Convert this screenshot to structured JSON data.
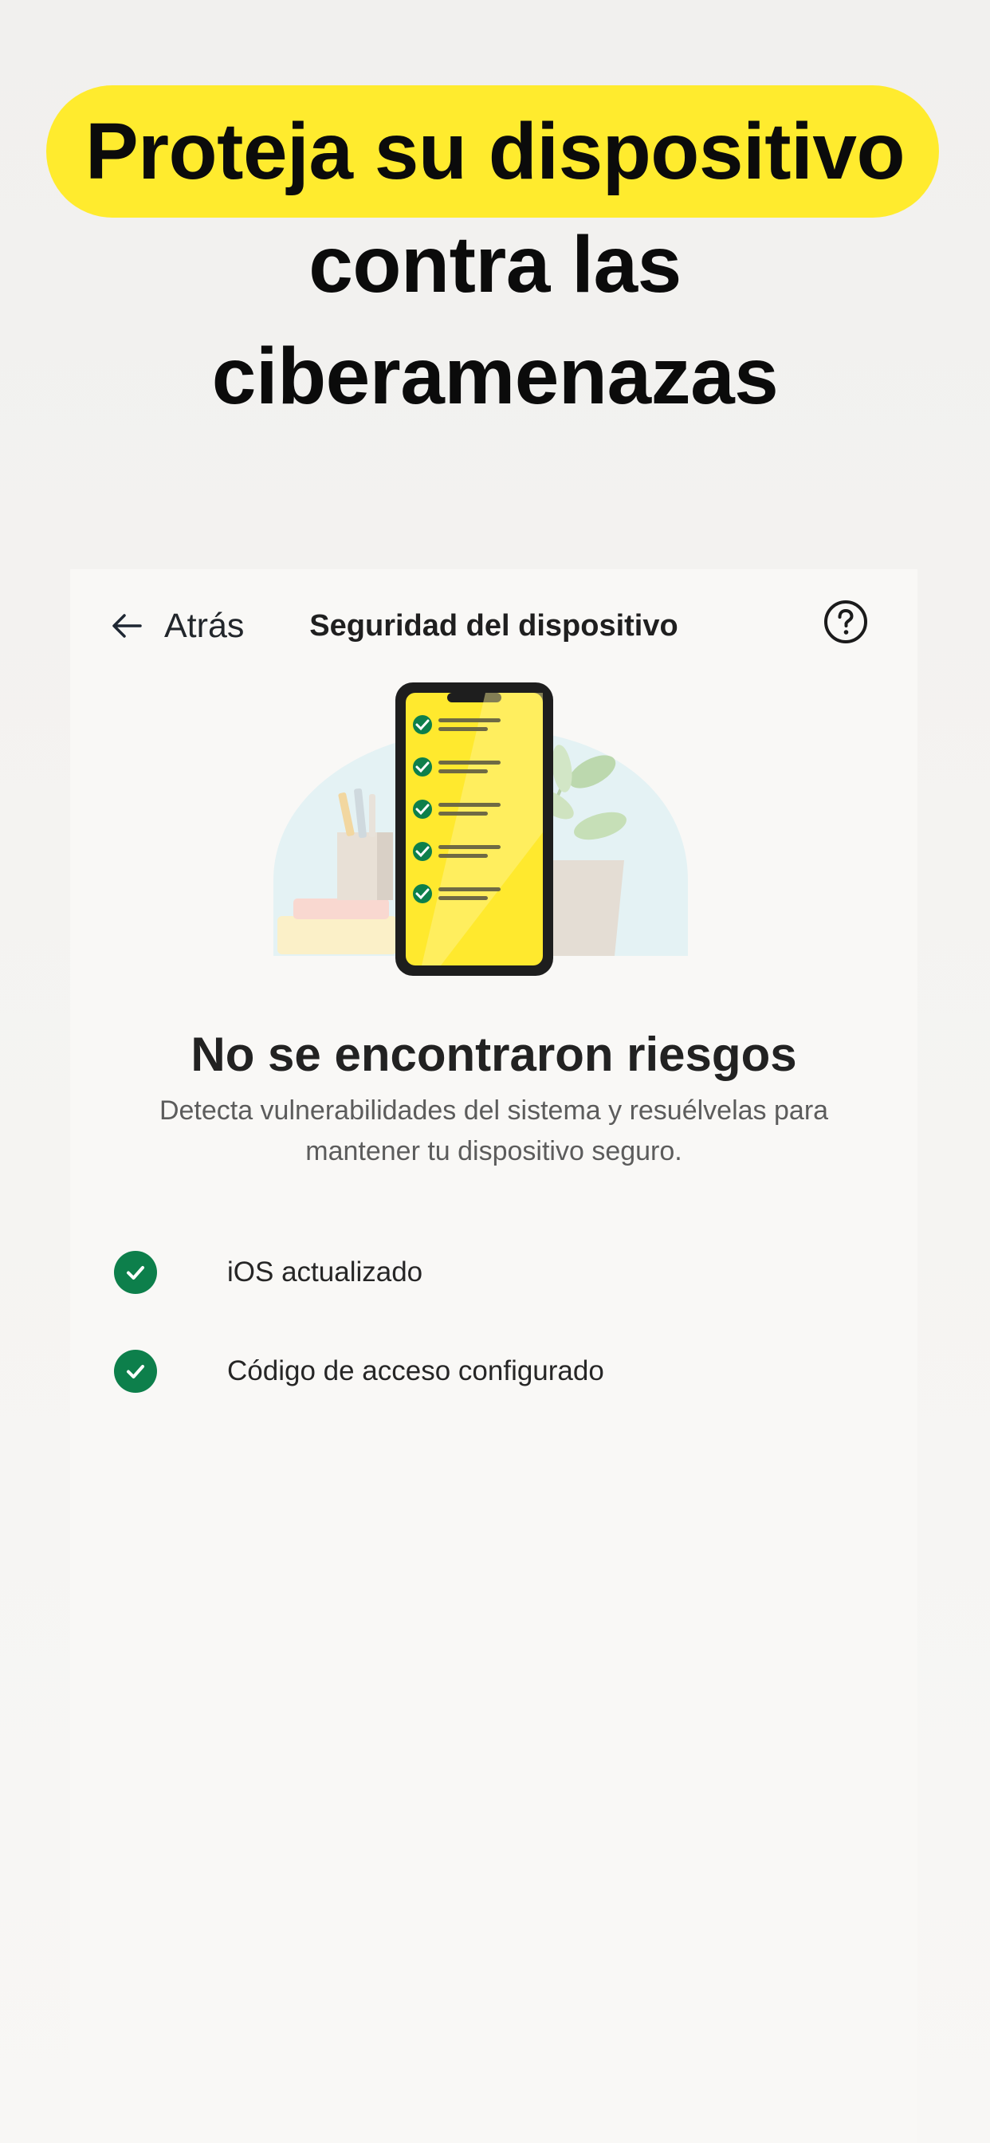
{
  "headline": {
    "line1": "Proteja su dispositivo",
    "line2": "contra las",
    "line3": "ciberamenazas",
    "highlight_color": "#ffeb2e"
  },
  "nav": {
    "back_icon": "arrow-left-icon",
    "back_label": "Atrás",
    "title": "Seguridad del dispositivo",
    "help_icon": "question-circle-icon"
  },
  "illustration": {
    "name": "phone-checklist-illustration",
    "checklist_items": 5,
    "accent_color": "#ffe92e",
    "check_color": "#0d7f4b"
  },
  "status": {
    "title": "No se encontraron riesgos",
    "description": "Detecta vulnerabilidades del sistema y resuélvelas para mantener tu dispositivo seguro."
  },
  "checks": [
    {
      "label": "iOS actualizado",
      "icon": "check-circle-icon",
      "state": "ok"
    },
    {
      "label": "Código de acceso configurado",
      "icon": "check-circle-icon",
      "state": "ok"
    }
  ]
}
